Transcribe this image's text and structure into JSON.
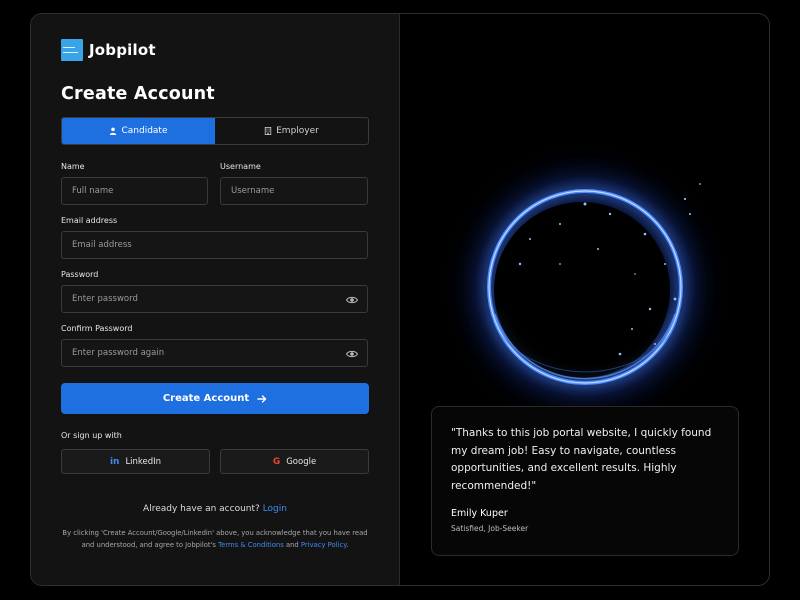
{
  "brand": {
    "name": "Jobpilot"
  },
  "form": {
    "title": "Create Account",
    "tabs": [
      {
        "label": "Candidate",
        "icon": "user-icon",
        "active": true
      },
      {
        "label": "Employer",
        "icon": "building-icon",
        "active": false
      }
    ],
    "fields": {
      "name": {
        "label": "Name",
        "placeholder": "Full name"
      },
      "username": {
        "label": "Username",
        "placeholder": "Username"
      },
      "email": {
        "label": "Email address",
        "placeholder": "Email address"
      },
      "password": {
        "label": "Password",
        "placeholder": "Enter password"
      },
      "confirm": {
        "label": "Confirm Password",
        "placeholder": "Enter password again"
      }
    },
    "submit_label": "Create Account",
    "or_signup": "Or sign up with",
    "social": {
      "linkedin": "LinkedIn",
      "google": "Google"
    },
    "already": {
      "text": "Already have an account?",
      "link": "Login"
    },
    "terms": {
      "prefix": "By clicking 'Create Account/Google/Linkedin' above, you acknowledge that you have read and understood, and agree to Jobpilot's",
      "terms_link": "Terms & Conditions",
      "and": "and",
      "privacy_link": "Privacy Policy",
      "suffix": "."
    }
  },
  "testimonial": {
    "quote": "\"Thanks to this job portal website, I quickly found my dream job! Easy to navigate, countless opportunities, and excellent results. Highly recommended!\"",
    "name": "Emily Kuper",
    "role": "Satisfied, Job-Seeker"
  },
  "colors": {
    "accent": "#1e6fe0",
    "link": "#3f8cf5",
    "panel": "#131313",
    "ring": "#3d7bff"
  }
}
